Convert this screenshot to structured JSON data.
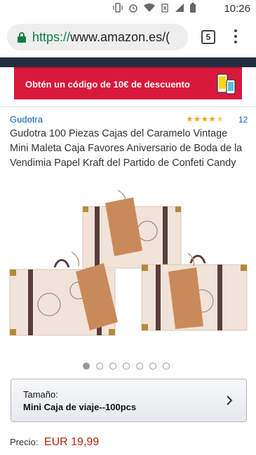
{
  "status_bar": {
    "time": "10:26",
    "icons": [
      "vibrate-icon",
      "alarm-icon",
      "wifi-icon",
      "no-signal-icon",
      "signal-icon",
      "battery-icon"
    ]
  },
  "browser": {
    "url_scheme": "https://",
    "url_host": "www.amazon.es/(",
    "tab_count": "5"
  },
  "promo": {
    "text": "Obtén un código de 10€ de descuento"
  },
  "product": {
    "brand": "Gudotra",
    "rating_stars": 4.5,
    "review_count": "12",
    "title": "Gudotra 100 Piezas Cajas del Caramelo Vintage Mini Maleta Caja Favores Aniversario de Boda de la Vendimia Papel Kraft del Partido de Confeti Candy"
  },
  "carousel": {
    "total": 7,
    "active_index": 0
  },
  "size_selector": {
    "label": "Tamaño:",
    "value": "Mini Caja de viaje--100pcs"
  },
  "price": {
    "label": "Precio:",
    "value": "EUR 19,99"
  },
  "colors": {
    "accent_red": "#d9193c",
    "header_navy": "#232f3e",
    "link_blue": "#0066c0",
    "price_red": "#b12704",
    "star_orange": "#f4a41c"
  }
}
